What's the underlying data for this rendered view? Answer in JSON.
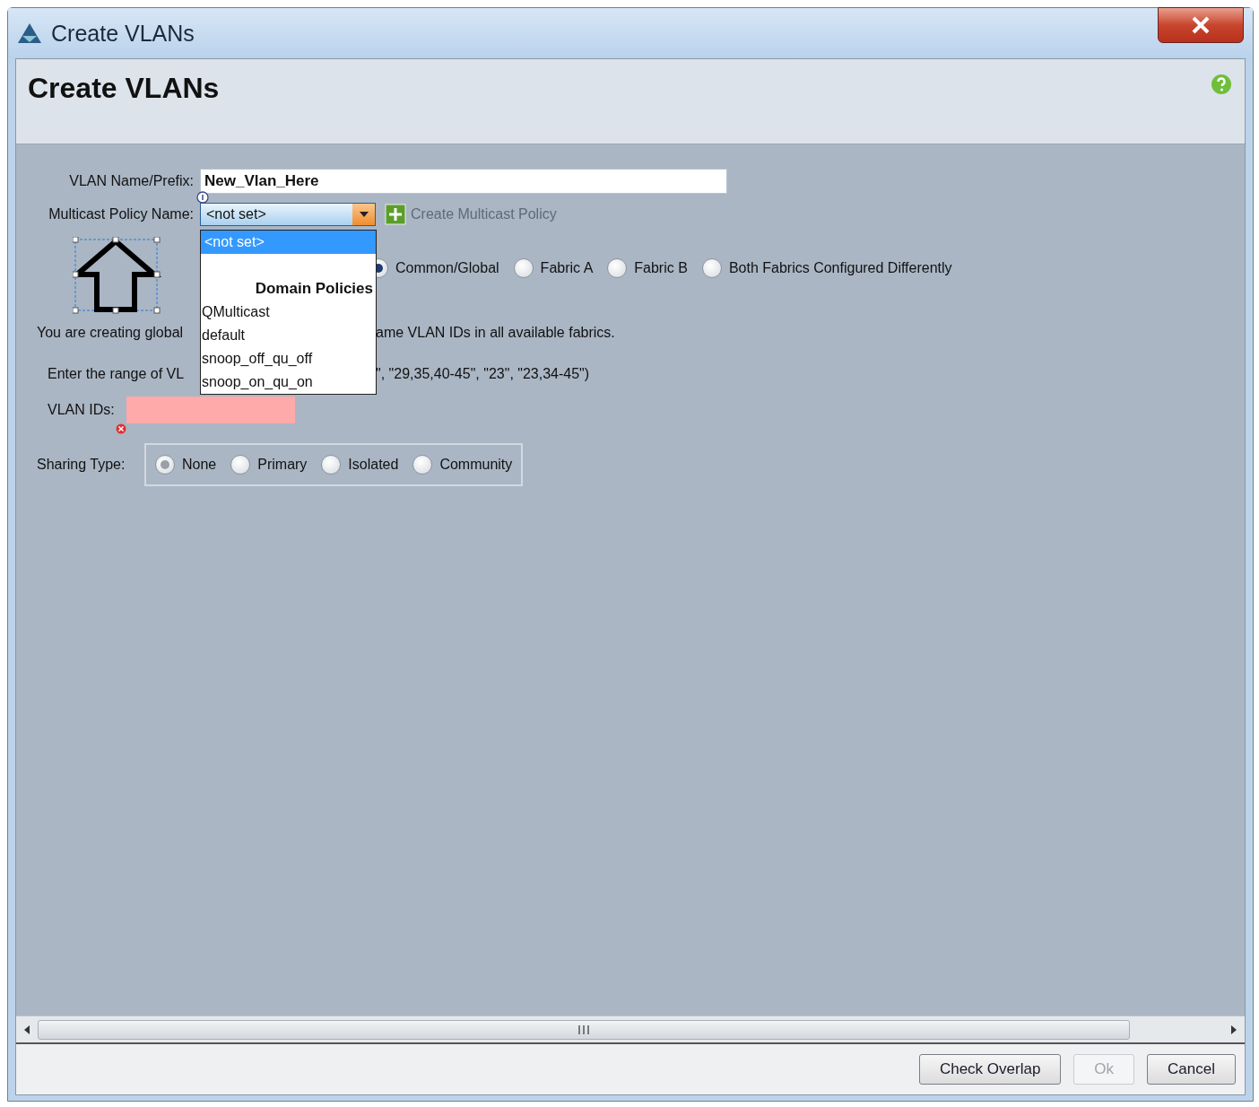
{
  "window": {
    "title": "Create VLANs"
  },
  "header": {
    "title": "Create VLANs"
  },
  "form": {
    "name_label": "VLAN Name/Prefix:",
    "name_value": "New_Vlan_Here",
    "multicast_label": "Multicast Policy Name:",
    "multicast_value": "<not set>",
    "create_policy_link": "Create Multicast Policy"
  },
  "dropdown": {
    "expanded": true,
    "options": [
      {
        "kind": "option",
        "label": "<not set>",
        "selected": true
      },
      {
        "kind": "header",
        "label": "Domain Policies"
      },
      {
        "kind": "option",
        "label": "QMulticast",
        "selected": false
      },
      {
        "kind": "option",
        "label": "default",
        "selected": false
      },
      {
        "kind": "option",
        "label": "snoop_off_qu_off",
        "selected": false
      },
      {
        "kind": "option",
        "label": "snoop_on_qu_on",
        "selected": false
      }
    ]
  },
  "fabric_options": [
    {
      "label": "Common/Global",
      "selected": true
    },
    {
      "label": "Fabric A",
      "selected": false
    },
    {
      "label": "Fabric B",
      "selected": false
    },
    {
      "label": "Both Fabrics Configured Differently",
      "selected": false
    }
  ],
  "info_text": [
    "You are creating global",
    "ame VLAN IDs in all available fabrics."
  ],
  "range_text": [
    "Enter the range of VL",
    "\", \"29,35,40-45\", \"23\", \"23,34-45\")"
  ],
  "vlan_ids": {
    "label": "VLAN IDs:",
    "invalid": true
  },
  "sharing": {
    "label": "Sharing Type:",
    "options": [
      {
        "label": "None",
        "selected": true
      },
      {
        "label": "Primary",
        "selected": false
      },
      {
        "label": "Isolated",
        "selected": false
      },
      {
        "label": "Community",
        "selected": false
      }
    ]
  },
  "buttons": [
    {
      "label": "Check Overlap",
      "disabled": false
    },
    {
      "label": "Ok",
      "disabled": true
    },
    {
      "label": "Cancel",
      "disabled": false
    }
  ]
}
